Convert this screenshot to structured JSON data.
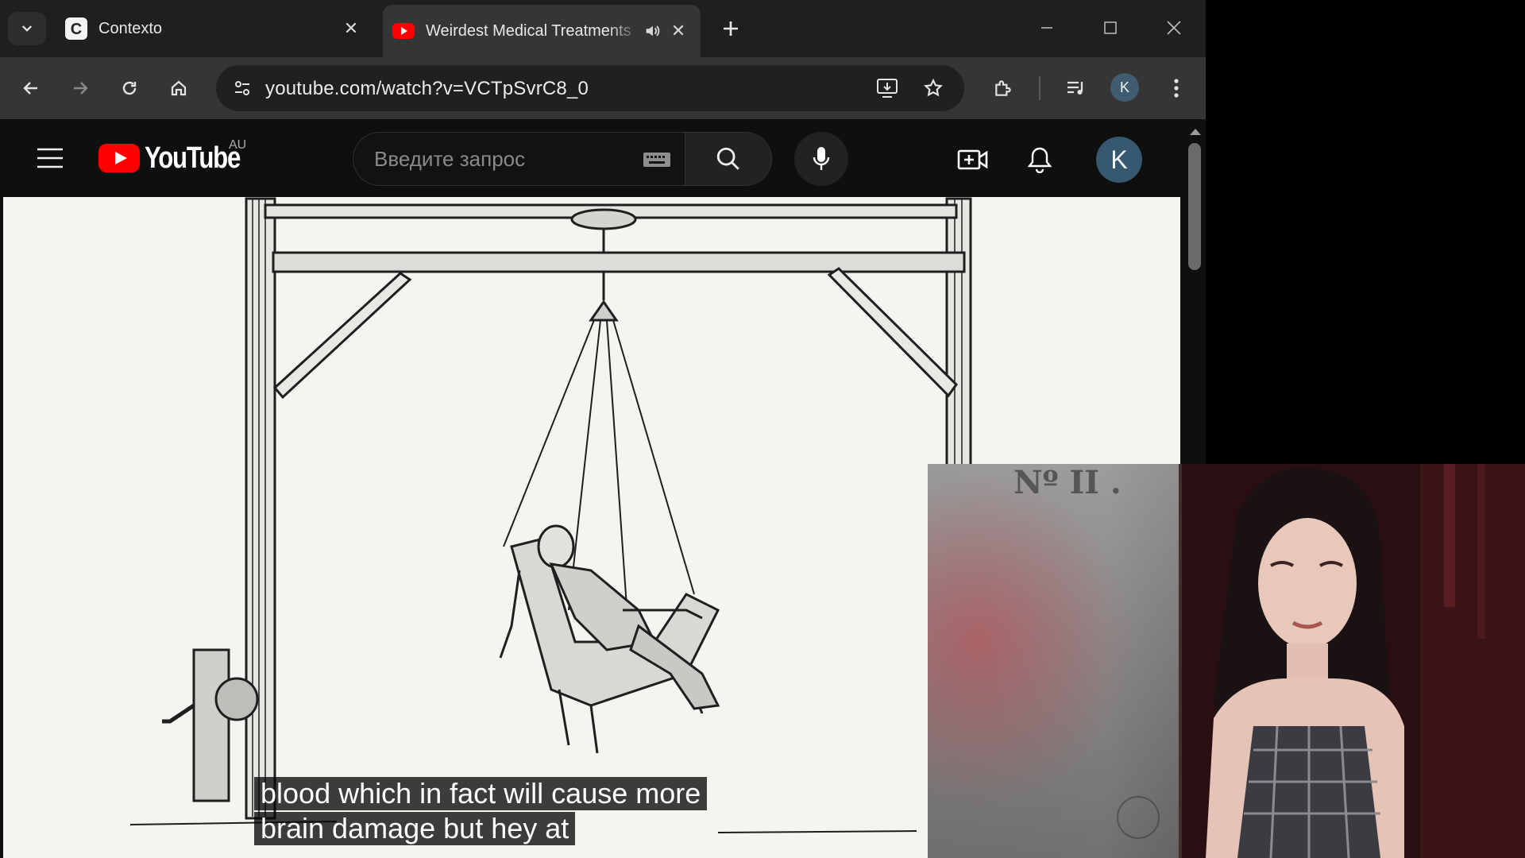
{
  "browser": {
    "tabs": [
      {
        "title": "Contexto",
        "favicon": "contexto-c-icon",
        "active": false
      },
      {
        "title": "Weirdest Medical Treatments",
        "favicon": "youtube-icon",
        "active": true,
        "audio": true
      }
    ],
    "url": "youtube.com/watch?v=VCTpSvrC8_0",
    "profile_initial": "K",
    "colors": {
      "tabstrip": "#1f1f1f",
      "toolbar": "#353535",
      "omnibox": "#202020"
    }
  },
  "youtube": {
    "logo_text": "YouTube",
    "country_code": "AU",
    "search_placeholder": "Введите запрос",
    "avatar_initial": "K",
    "brand_red": "#ff0000"
  },
  "video": {
    "captions": [
      "blood which in fact will cause more",
      "brain damage but hey at"
    ]
  },
  "webcam": {
    "overlay_text": "Nº II ."
  }
}
